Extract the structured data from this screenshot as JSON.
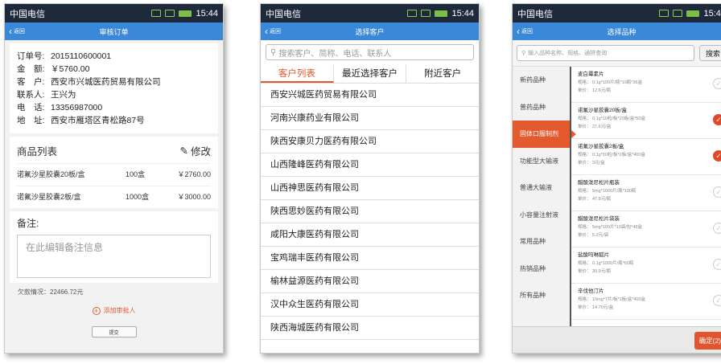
{
  "status": {
    "carrier": "中国电信",
    "time": "15:44"
  },
  "back_label": "返回",
  "screen1": {
    "title": "审核订单",
    "order": [
      {
        "k": "订单号:",
        "v": "2015110600001"
      },
      {
        "k": "金　额:",
        "v": "￥5760.00"
      },
      {
        "k": "客　户:",
        "v": "西安市兴城医药贸易有限公司"
      },
      {
        "k": "联系人:",
        "v": "王兴为"
      },
      {
        "k": "电　话:",
        "v": "13356987000"
      },
      {
        "k": "地　址:",
        "v": "西安市雁塔区青松路87号"
      }
    ],
    "list_title": "商品列表",
    "edit_label": "修改",
    "products": [
      {
        "name": "诺氟沙星胶囊20板/盒",
        "qty": "100盒",
        "price": "￥2760.00"
      },
      {
        "name": "诺氟沙星胶囊2板/盒",
        "qty": "1000盒",
        "price": "￥3000.00"
      }
    ],
    "remark_title": "备注:",
    "remark_placeholder": "在此编辑备注信息",
    "debt": "欠款情况：22466.72元",
    "add_approver": "添加审批人",
    "submit": "提交"
  },
  "screen2": {
    "title": "选择客户",
    "search_placeholder": "搜索客户、简称、电话、联系人",
    "tabs": [
      "客户列表",
      "最近选择客户",
      "附近客户"
    ],
    "customers": [
      "西安兴城医药贸易有限公司",
      "河南兴康药业有限公司",
      "陕西安康贝力医药有限公司",
      "山西隆峰医药有限公司",
      "山西神思医药有限公司",
      "陕西思妙医药有限公司",
      "咸阳大康医药有限公司",
      "宝鸡瑞丰医药有限公司",
      "榆林益源医药有限公司",
      "汉中众生医药有限公司",
      "陕西海城医药有限公司"
    ]
  },
  "screen3": {
    "title": "选择品种",
    "search_placeholder": "输入品种名称、规格、通拼查询",
    "search_button": "搜索",
    "categories": [
      "新药品种",
      "普药品种",
      "固体口服制剂",
      "功能型大输液",
      "普通大输液",
      "小容量注射液",
      "常用品种",
      "热销品种",
      "所有品种"
    ],
    "spec_label": "规格：",
    "price_label": "单价：",
    "products": [
      {
        "name": "麦白霉素片",
        "spec": "0.1g*100片/瓶*10瓶*36盒",
        "price": "12.6元/瓶",
        "checked": false
      },
      {
        "name": "诺氟沙星胶囊20板/盒",
        "spec": "0.1g*10粒/板*20板/盒*50盒",
        "price": "27.6元/盒",
        "checked": true
      },
      {
        "name": "诺氟沙星胶囊2板/盒",
        "spec": "0.1g*10粒/板*2板/盒*400盒",
        "price": "3元/盒",
        "checked": true
      },
      {
        "name": "醋酸泼尼松片瓶装",
        "spec": "5mg*1000片/瓶*100瓶",
        "price": "47.8元/瓶",
        "checked": false
      },
      {
        "name": "醋酸泼尼松片袋装",
        "spec": "5mg*100片*10袋/包*48盒",
        "price": "5.2元/袋",
        "checked": false
      },
      {
        "name": "盐酸吗啉胍片",
        "spec": "0.1g*1000片/瓶*60瓶",
        "price": "30.9元/瓶",
        "checked": false
      },
      {
        "name": "辛伐他汀片",
        "spec": "10mg*7片/板*1板/盒*400盒",
        "price": "14.70元/盒",
        "checked": false
      }
    ],
    "confirm": "确定(2)"
  }
}
